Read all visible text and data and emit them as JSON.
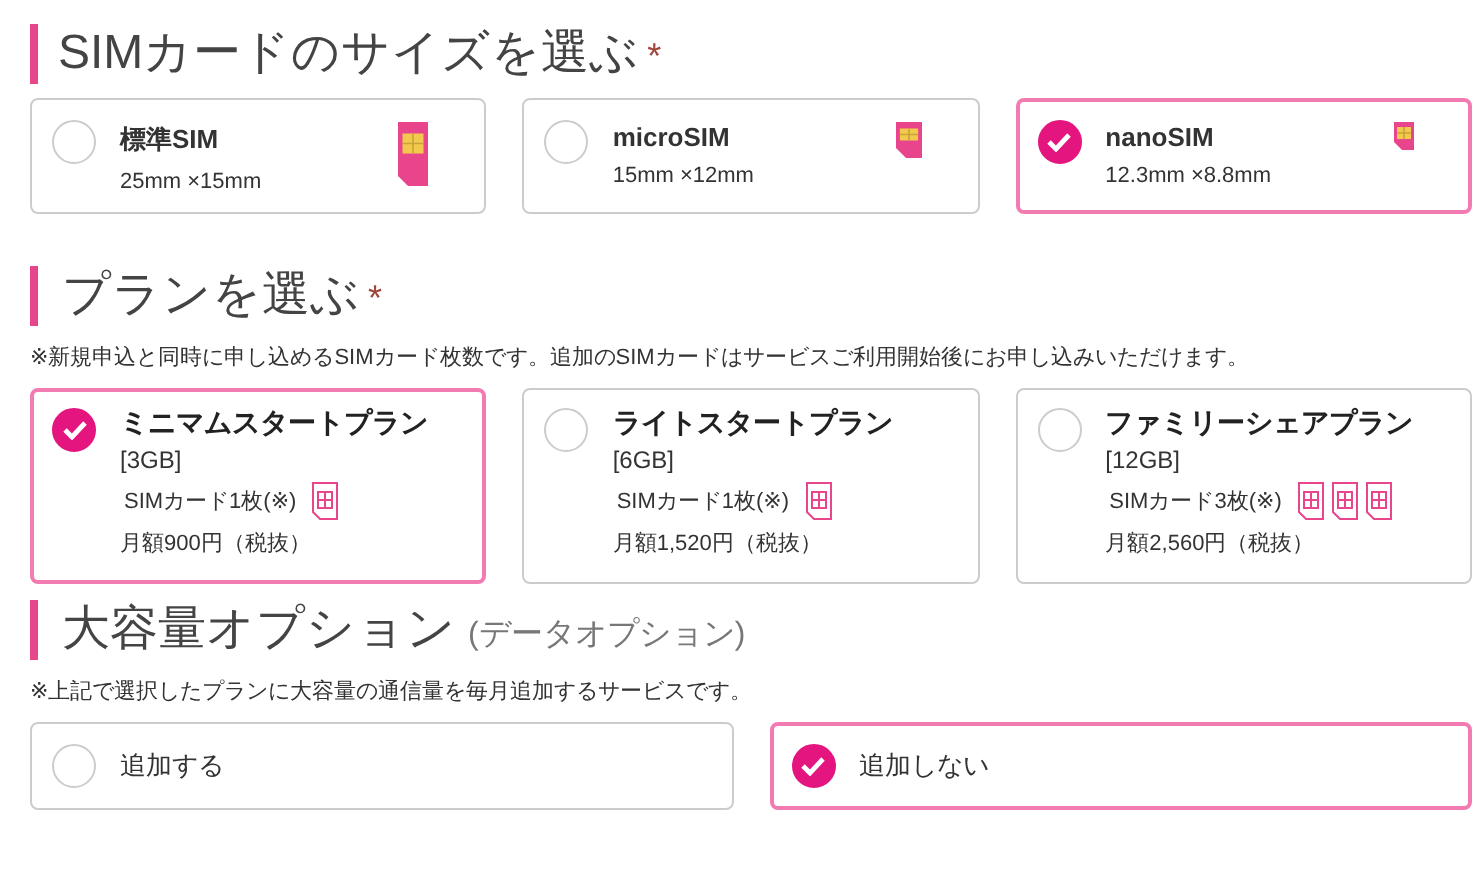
{
  "sections": [
    {
      "title": "SIMカードのサイズを選ぶ",
      "required_mark": "*",
      "kind": "size",
      "options": [
        {
          "name": "標準SIM",
          "size": "25mm ×15mm",
          "kind": "standard",
          "selected": false
        },
        {
          "name": "microSIM",
          "size": "15mm ×12mm",
          "kind": "micro",
          "selected": false
        },
        {
          "name": "nanoSIM",
          "size": "12.3mm ×8.8mm",
          "kind": "nano",
          "selected": true
        }
      ]
    },
    {
      "title": "プランを選ぶ",
      "required_mark": "*",
      "note": "※新規申込と同時に申し込めるSIMカード枚数です。追加のSIMカードはサービスご利用開始後にお申し込みいただけます。",
      "kind": "plan",
      "options": [
        {
          "name": "ミニマムスタートプラン",
          "data": "[3GB]",
          "sims": "SIMカード1枚(※)",
          "sim_icons": [
            {
              "kind": "card"
            }
          ],
          "price": "月額900円（税抜）",
          "selected": true
        },
        {
          "name": "ライトスタートプラン",
          "data": "[6GB]",
          "sims": "SIMカード1枚(※)",
          "sim_icons": [
            {
              "kind": "card"
            }
          ],
          "price": "月額1,520円（税抜）",
          "selected": false
        },
        {
          "name": "ファミリーシェアプラン",
          "data": "[12GB]",
          "sims": "SIMカード3枚(※)",
          "sim_icons": [
            {
              "kind": "card"
            },
            {
              "kind": "card"
            },
            {
              "kind": "card"
            }
          ],
          "price": "月額2,560円（税抜）",
          "selected": false
        }
      ]
    },
    {
      "title": "大容量オプション",
      "subtitle": "(データオプション)",
      "note": "※上記で選択したプランに大容量の通信量を毎月追加するサービスです。",
      "kind": "option",
      "options": [
        {
          "name": "追加する",
          "selected": false
        },
        {
          "name": "追加しない",
          "selected": true
        }
      ]
    }
  ]
}
